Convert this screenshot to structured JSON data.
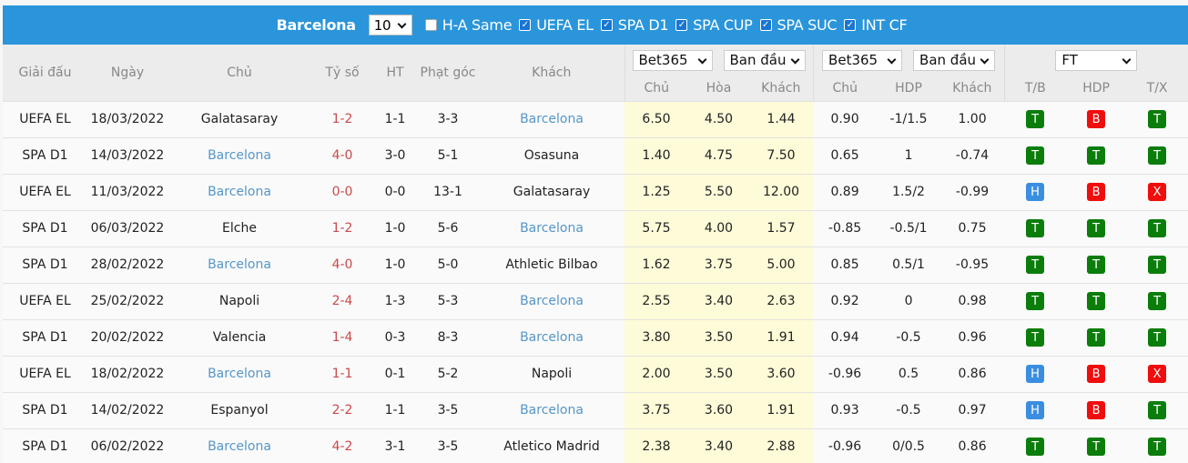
{
  "topbar": {
    "team": "Barcelona",
    "count_select": "10",
    "filters": [
      {
        "label": "H-A Same",
        "checked": false
      },
      {
        "label": "UEFA EL",
        "checked": true
      },
      {
        "label": "SPA D1",
        "checked": true
      },
      {
        "label": "SPA CUP",
        "checked": true
      },
      {
        "label": "SPA SUC",
        "checked": true
      },
      {
        "label": "INT CF",
        "checked": true
      }
    ]
  },
  "header": {
    "league": "Giải đấu",
    "date": "Ngày",
    "home": "Chủ",
    "score": "Tỷ số",
    "ht": "HT",
    "corners": "Phạt góc",
    "away": "Khách",
    "odds1_bookmaker": "Bet365",
    "odds1_type": "Ban đầu",
    "odds2_bookmaker": "Bet365",
    "odds2_type": "Ban đầu",
    "result_select": "FT",
    "odds1_cols": [
      "Chủ",
      "Hòa",
      "Khách"
    ],
    "odds2_cols": [
      "Chủ",
      "HDP",
      "Khách"
    ],
    "result_cols": [
      "T/B",
      "HDP",
      "T/X"
    ]
  },
  "rows": [
    {
      "league": "UEFA EL",
      "date": "18/03/2022",
      "home": "Galatasaray",
      "home_hl": false,
      "score": "1-2",
      "ht": "1-1",
      "corners": "3-3",
      "away": "Barcelona",
      "away_hl": true,
      "o1": [
        "6.50",
        "4.50",
        "1.44"
      ],
      "o2": [
        "0.90",
        "-1/1.5",
        "1.00"
      ],
      "res": [
        "T",
        "B",
        "T"
      ]
    },
    {
      "league": "SPA D1",
      "date": "14/03/2022",
      "home": "Barcelona",
      "home_hl": true,
      "score": "4-0",
      "ht": "3-0",
      "corners": "5-1",
      "away": "Osasuna",
      "away_hl": false,
      "o1": [
        "1.40",
        "4.75",
        "7.50"
      ],
      "o2": [
        "0.65",
        "1",
        "-0.74"
      ],
      "res": [
        "T",
        "T",
        "T"
      ]
    },
    {
      "league": "UEFA EL",
      "date": "11/03/2022",
      "home": "Barcelona",
      "home_hl": true,
      "score": "0-0",
      "ht": "0-0",
      "corners": "13-1",
      "away": "Galatasaray",
      "away_hl": false,
      "o1": [
        "1.25",
        "5.50",
        "12.00"
      ],
      "o2": [
        "0.89",
        "1.5/2",
        "-0.99"
      ],
      "res": [
        "H",
        "B",
        "X"
      ]
    },
    {
      "league": "SPA D1",
      "date": "06/03/2022",
      "home": "Elche",
      "home_hl": false,
      "score": "1-2",
      "ht": "1-0",
      "corners": "5-6",
      "away": "Barcelona",
      "away_hl": true,
      "o1": [
        "5.75",
        "4.00",
        "1.57"
      ],
      "o2": [
        "-0.85",
        "-0.5/1",
        "0.75"
      ],
      "res": [
        "T",
        "T",
        "T"
      ]
    },
    {
      "league": "SPA D1",
      "date": "28/02/2022",
      "home": "Barcelona",
      "home_hl": true,
      "score": "4-0",
      "ht": "1-0",
      "corners": "5-0",
      "away": "Athletic Bilbao",
      "away_hl": false,
      "o1": [
        "1.62",
        "3.75",
        "5.00"
      ],
      "o2": [
        "0.85",
        "0.5/1",
        "-0.95"
      ],
      "res": [
        "T",
        "T",
        "T"
      ]
    },
    {
      "league": "UEFA EL",
      "date": "25/02/2022",
      "home": "Napoli",
      "home_hl": false,
      "score": "2-4",
      "ht": "1-3",
      "corners": "5-3",
      "away": "Barcelona",
      "away_hl": true,
      "o1": [
        "2.55",
        "3.40",
        "2.63"
      ],
      "o2": [
        "0.92",
        "0",
        "0.98"
      ],
      "res": [
        "T",
        "T",
        "T"
      ]
    },
    {
      "league": "SPA D1",
      "date": "20/02/2022",
      "home": "Valencia",
      "home_hl": false,
      "score": "1-4",
      "ht": "0-3",
      "corners": "8-3",
      "away": "Barcelona",
      "away_hl": true,
      "o1": [
        "3.80",
        "3.50",
        "1.91"
      ],
      "o2": [
        "0.94",
        "-0.5",
        "0.96"
      ],
      "res": [
        "T",
        "T",
        "T"
      ]
    },
    {
      "league": "UEFA EL",
      "date": "18/02/2022",
      "home": "Barcelona",
      "home_hl": true,
      "score": "1-1",
      "ht": "0-1",
      "corners": "5-2",
      "away": "Napoli",
      "away_hl": false,
      "o1": [
        "2.00",
        "3.50",
        "3.60"
      ],
      "o2": [
        "-0.96",
        "0.5",
        "0.86"
      ],
      "res": [
        "H",
        "B",
        "X"
      ]
    },
    {
      "league": "SPA D1",
      "date": "14/02/2022",
      "home": "Espanyol",
      "home_hl": false,
      "score": "2-2",
      "ht": "1-1",
      "corners": "3-5",
      "away": "Barcelona",
      "away_hl": true,
      "o1": [
        "3.75",
        "3.60",
        "1.91"
      ],
      "o2": [
        "0.93",
        "-0.5",
        "0.97"
      ],
      "res": [
        "H",
        "B",
        "T"
      ]
    },
    {
      "league": "SPA D1",
      "date": "06/02/2022",
      "home": "Barcelona",
      "home_hl": true,
      "score": "4-2",
      "ht": "3-1",
      "corners": "3-5",
      "away": "Atletico Madrid",
      "away_hl": false,
      "o1": [
        "2.38",
        "3.40",
        "2.88"
      ],
      "o2": [
        "-0.96",
        "0/0.5",
        "0.86"
      ],
      "res": [
        "T",
        "T",
        "T"
      ]
    }
  ],
  "colors": {
    "topbar": "#2a95db",
    "team_link": "#5596c8",
    "score": "#c94a4a",
    "odds_highlight": "#fefbd8",
    "badge_T": "#0b7d0b",
    "badge_B": "#f00d0d",
    "badge_H": "#3a8ee0",
    "badge_X": "#f00d0d"
  }
}
